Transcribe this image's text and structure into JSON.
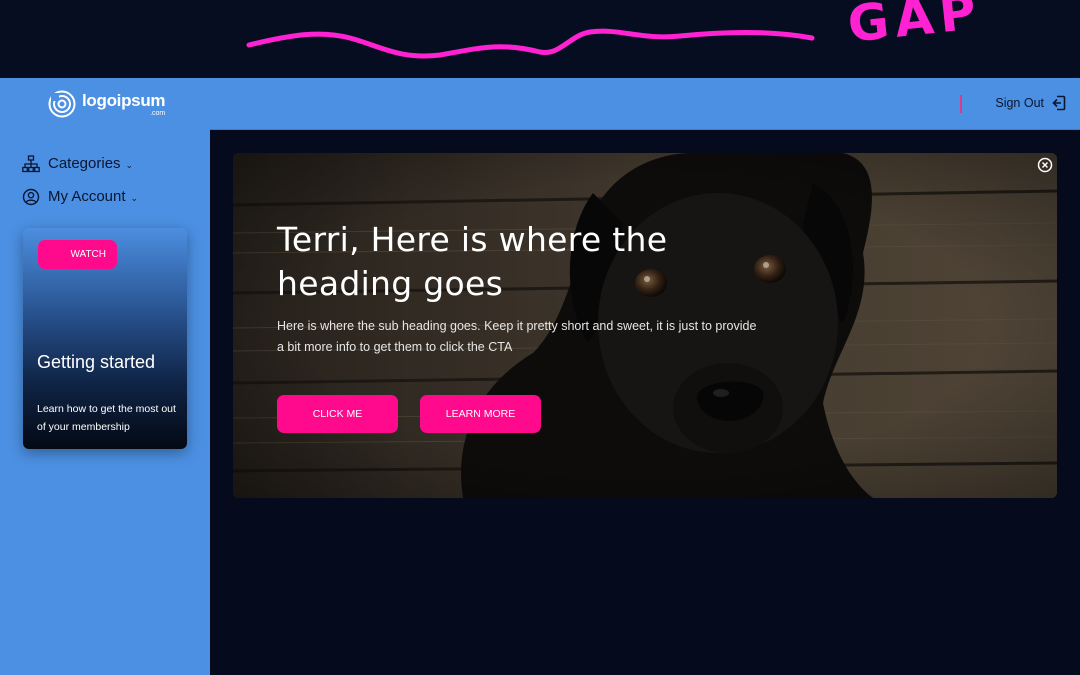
{
  "annotation": {
    "label": "GAP",
    "color": "#ff22d2"
  },
  "brand": {
    "name": "logoipsum",
    "suffix": ".com",
    "icon": "logo-mark-icon"
  },
  "sidebar": {
    "items": [
      {
        "label": "Categories",
        "icon": "sitemap-icon",
        "chevron": "⌄"
      },
      {
        "label": "My Account",
        "icon": "user-circle-icon",
        "chevron": "⌄"
      }
    ],
    "promo": {
      "button_label": "WATCH",
      "title": "Getting started",
      "description": "Learn how to get the most out of your membership"
    }
  },
  "topbar": {
    "signout_label": "Sign Out",
    "signout_icon": "sign-out-icon"
  },
  "hero": {
    "heading": "Terri, Here is where the heading goes",
    "subheading": "Here is where the sub heading goes. Keep it pretty short and sweet, it is just to provide a bit more info to get them to click the CTA",
    "primary_cta": "CLICK ME",
    "secondary_cta": "LEARN MORE",
    "close_icon": "close-icon",
    "image": "black-puppy-photo"
  },
  "colors": {
    "sidebar": "#4c90e3",
    "background": "#050b1c",
    "accent": "#ff0a8c"
  }
}
